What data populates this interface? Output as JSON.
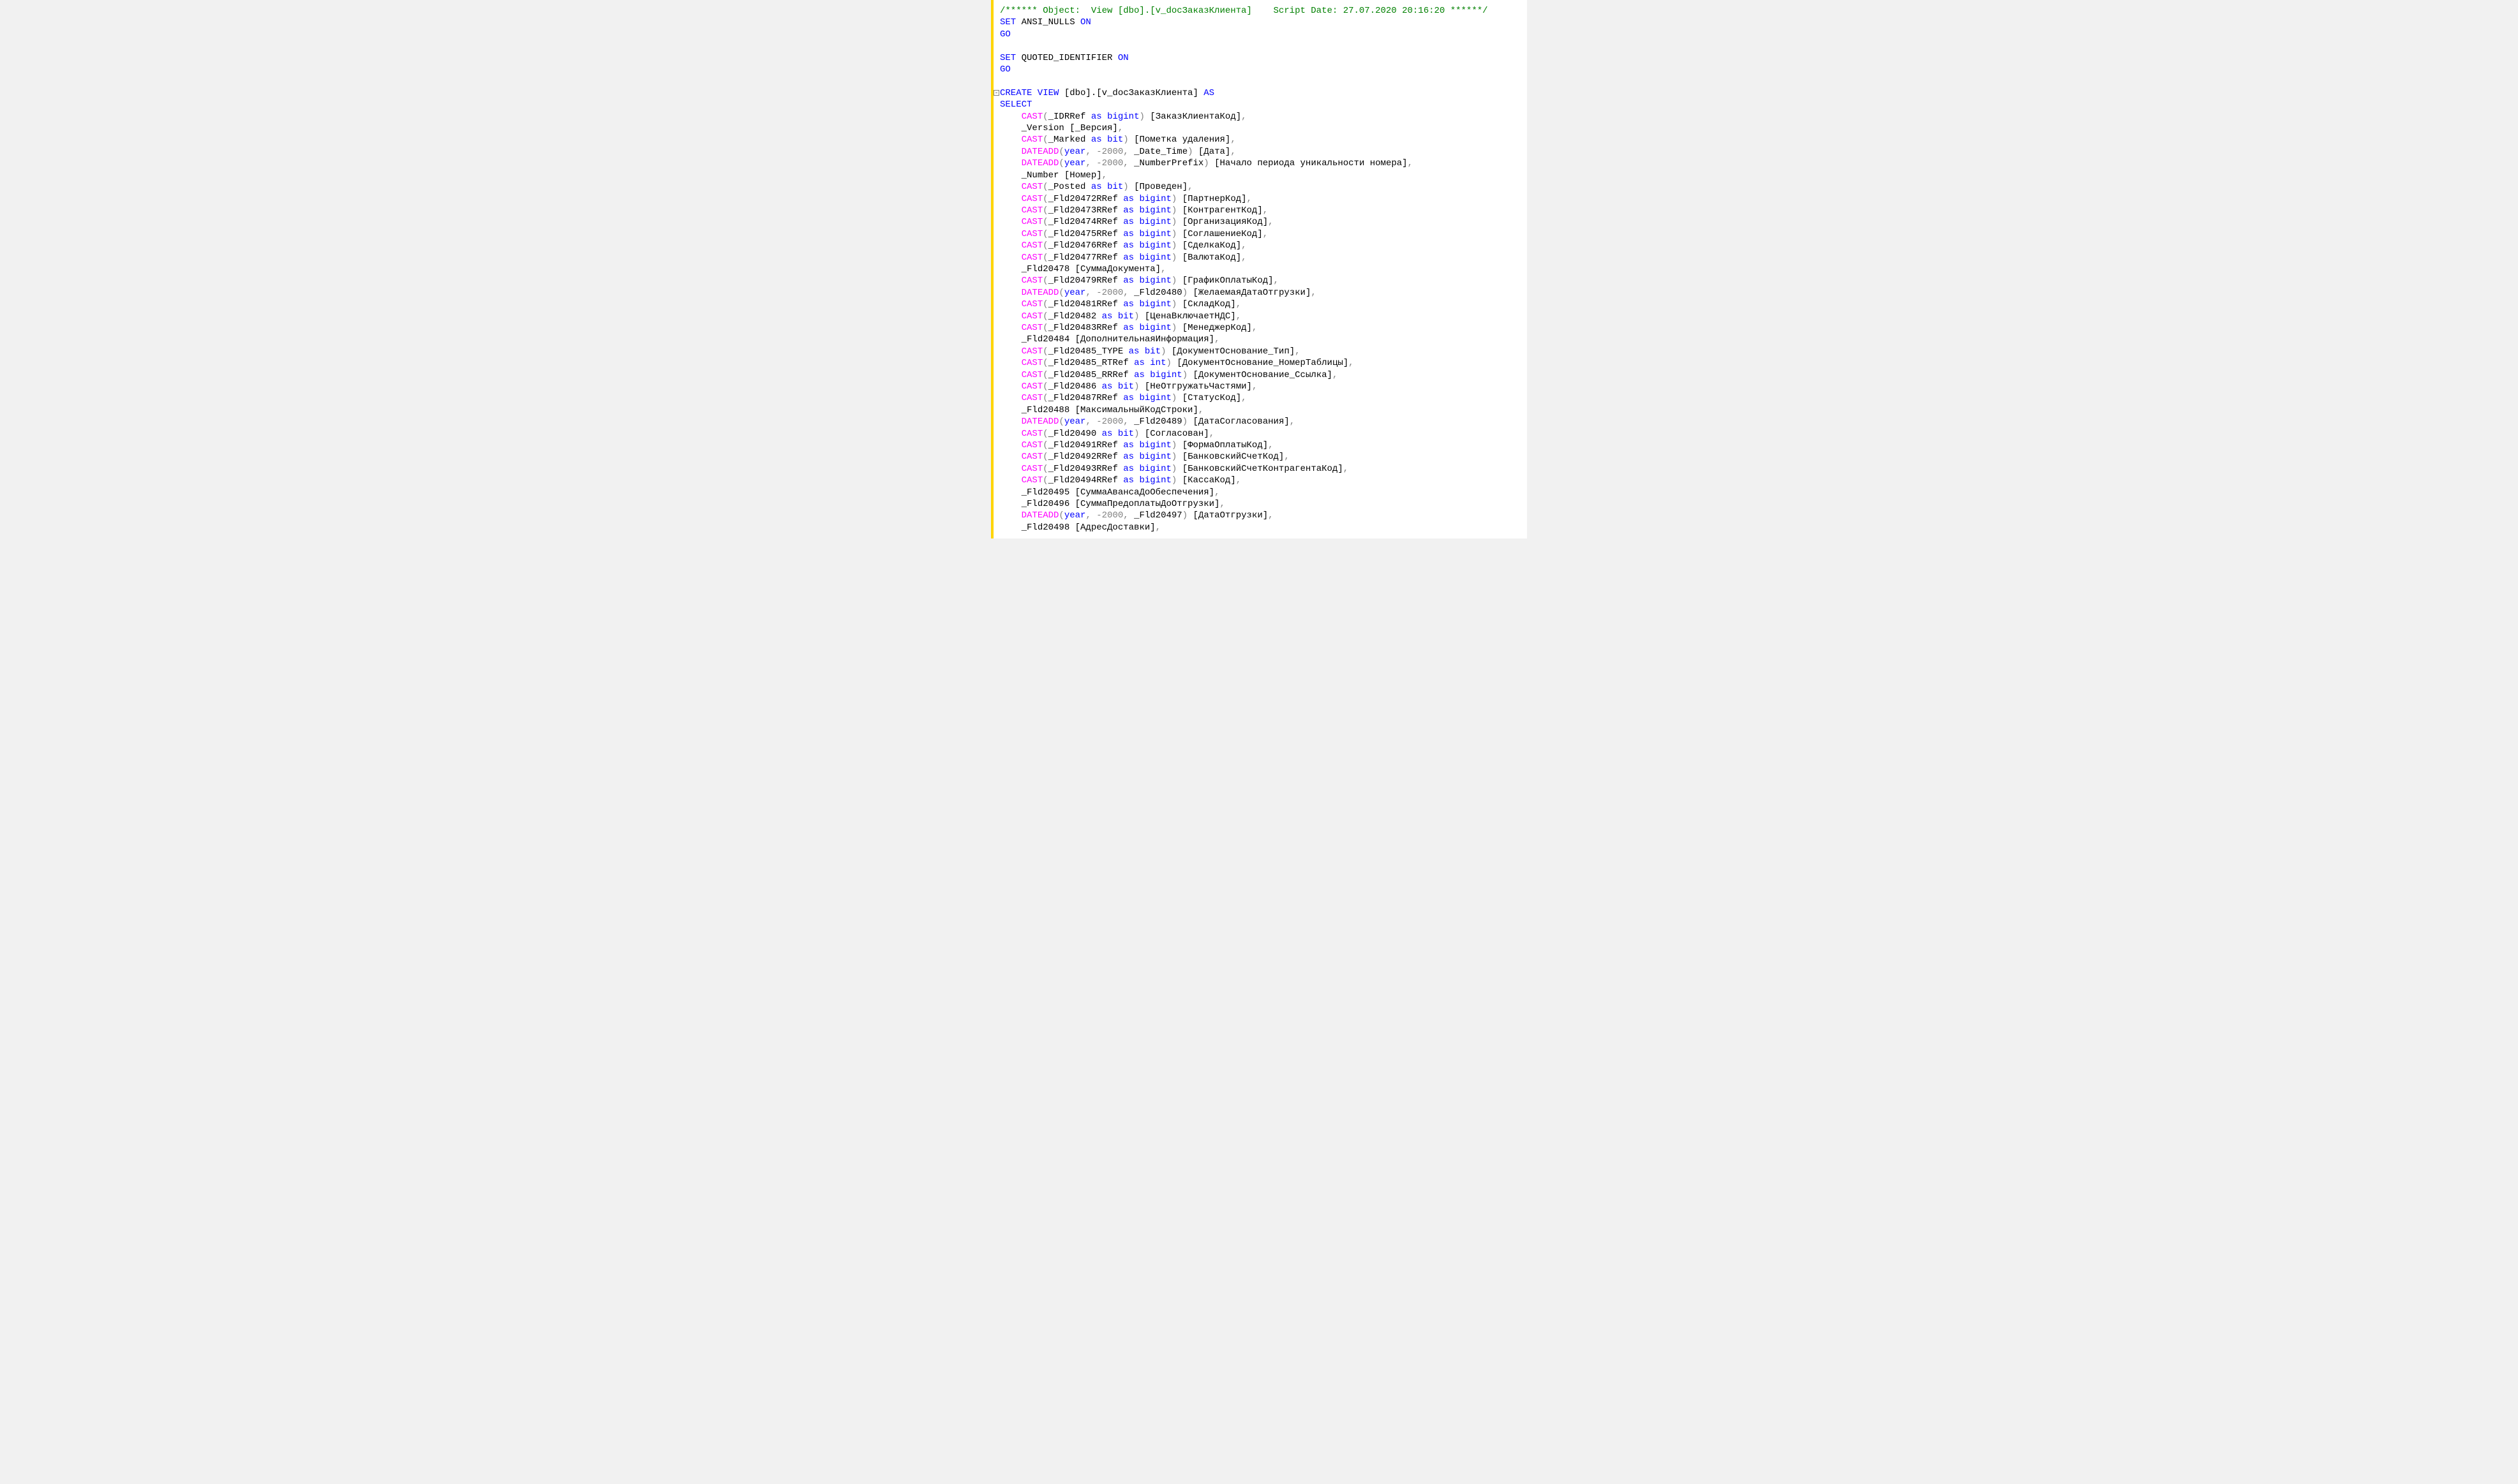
{
  "comment_line": "/****** Object:  View [dbo].[v_docЗаказКлиента]    Script Date: 27.07.2020 20:16:20 ******/",
  "set1": {
    "kw": "SET ",
    "ident": "ANSI_NULLS ",
    "kw2": "ON"
  },
  "go1": "GO",
  "set2": {
    "kw": "SET ",
    "ident": "QUOTED_IDENTIFIER ",
    "kw2": "ON"
  },
  "go2": "GO",
  "create": {
    "kw": "CREATE VIEW",
    "obj": " [dbo].[v_docЗаказКлиента] ",
    "kw2": "AS"
  },
  "select_kw": "SELECT",
  "lines": [
    {
      "type": "cast",
      "arg": "_IDRRef",
      "as": "bigint",
      "alias": "ЗаказКлиентаКод",
      "comma": true
    },
    {
      "type": "plain",
      "text": "_Version [_Версия]",
      "comma": true
    },
    {
      "type": "cast",
      "arg": "_Marked",
      "as": "bit",
      "alias": "Пометка удаления",
      "comma": true
    },
    {
      "type": "dateadd",
      "part": "year",
      "off": "-2000",
      "arg": "_Date_Time",
      "alias": "Дата",
      "comma": true
    },
    {
      "type": "dateadd",
      "part": "year",
      "off": "-2000",
      "arg": "_NumberPrefix",
      "alias": "Начало периода уникальности номера",
      "comma": true
    },
    {
      "type": "plain",
      "text": "_Number [Номер]",
      "comma": true
    },
    {
      "type": "cast",
      "arg": "_Posted",
      "as": "bit",
      "alias": "Проведен",
      "comma": true
    },
    {
      "type": "cast",
      "arg": "_Fld20472RRef",
      "as": "bigint",
      "alias": "ПартнерКод",
      "comma": true
    },
    {
      "type": "cast",
      "arg": "_Fld20473RRef",
      "as": "bigint",
      "alias": "КонтрагентКод",
      "comma": true
    },
    {
      "type": "cast",
      "arg": "_Fld20474RRef",
      "as": "bigint",
      "alias": "ОрганизацияКод",
      "comma": true
    },
    {
      "type": "cast",
      "arg": "_Fld20475RRef",
      "as": "bigint",
      "alias": "СоглашениеКод",
      "comma": true
    },
    {
      "type": "cast",
      "arg": "_Fld20476RRef",
      "as": "bigint",
      "alias": "СделкаКод",
      "comma": true
    },
    {
      "type": "cast",
      "arg": "_Fld20477RRef",
      "as": "bigint",
      "alias": "ВалютаКод",
      "comma": true
    },
    {
      "type": "plain",
      "text": "_Fld20478 [СуммаДокумента]",
      "comma": true
    },
    {
      "type": "cast",
      "arg": "_Fld20479RRef",
      "as": "bigint",
      "alias": "ГрафикОплатыКод",
      "comma": true
    },
    {
      "type": "dateadd",
      "part": "year",
      "off": "-2000",
      "arg": "_Fld20480",
      "alias": "ЖелаемаяДатаОтгрузки",
      "comma": true
    },
    {
      "type": "cast",
      "arg": "_Fld20481RRef",
      "as": "bigint",
      "alias": "СкладКод",
      "comma": true
    },
    {
      "type": "cast",
      "arg": "_Fld20482",
      "as": "bit",
      "alias": "ЦенаВключаетНДС",
      "comma": true
    },
    {
      "type": "cast",
      "arg": "_Fld20483RRef",
      "as": "bigint",
      "alias": "МенеджерКод",
      "comma": true
    },
    {
      "type": "plain",
      "text": "_Fld20484 [ДополнительнаяИнформация]",
      "comma": true
    },
    {
      "type": "cast",
      "arg": "_Fld20485_TYPE",
      "as": "bit",
      "alias": "ДокументОснование_Тип",
      "comma": true
    },
    {
      "type": "cast",
      "arg": "_Fld20485_RTRef",
      "as": "int",
      "alias": "ДокументОснование_НомерТаблицы",
      "comma": true
    },
    {
      "type": "cast",
      "arg": "_Fld20485_RRRef",
      "as": "bigint",
      "alias": "ДокументОснование_Ссылка",
      "comma": true
    },
    {
      "type": "cast",
      "arg": "_Fld20486",
      "as": "bit",
      "alias": "НеОтгружатьЧастями",
      "comma": true
    },
    {
      "type": "cast",
      "arg": "_Fld20487RRef",
      "as": "bigint",
      "alias": "СтатусКод",
      "comma": true
    },
    {
      "type": "plain",
      "text": "_Fld20488 [МаксимальныйКодСтроки]",
      "comma": true
    },
    {
      "type": "dateadd",
      "part": "year",
      "off": "-2000",
      "arg": "_Fld20489",
      "alias": "ДатаСогласования",
      "comma": true
    },
    {
      "type": "cast",
      "arg": "_Fld20490",
      "as": "bit",
      "alias": "Согласован",
      "comma": true
    },
    {
      "type": "cast",
      "arg": "_Fld20491RRef",
      "as": "bigint",
      "alias": "ФормаОплатыКод",
      "comma": true
    },
    {
      "type": "cast",
      "arg": "_Fld20492RRef",
      "as": "bigint",
      "alias": "БанковскийСчетКод",
      "comma": true
    },
    {
      "type": "cast",
      "arg": "_Fld20493RRef",
      "as": "bigint",
      "alias": "БанковскийСчетКонтрагентаКод",
      "comma": true
    },
    {
      "type": "cast",
      "arg": "_Fld20494RRef",
      "as": "bigint",
      "alias": "КассаКод",
      "comma": true
    },
    {
      "type": "plain",
      "text": "_Fld20495 [СуммаАвансаДоОбеспечения]",
      "comma": true
    },
    {
      "type": "plain",
      "text": "_Fld20496 [СуммаПредоплатыДоОтгрузки]",
      "comma": true
    },
    {
      "type": "dateadd",
      "part": "year",
      "off": "-2000",
      "arg": "_Fld20497",
      "alias": "ДатаОтгрузки",
      "comma": true
    },
    {
      "type": "plain",
      "text": "_Fld20498 [АдресДоставки]",
      "comma": true
    }
  ]
}
